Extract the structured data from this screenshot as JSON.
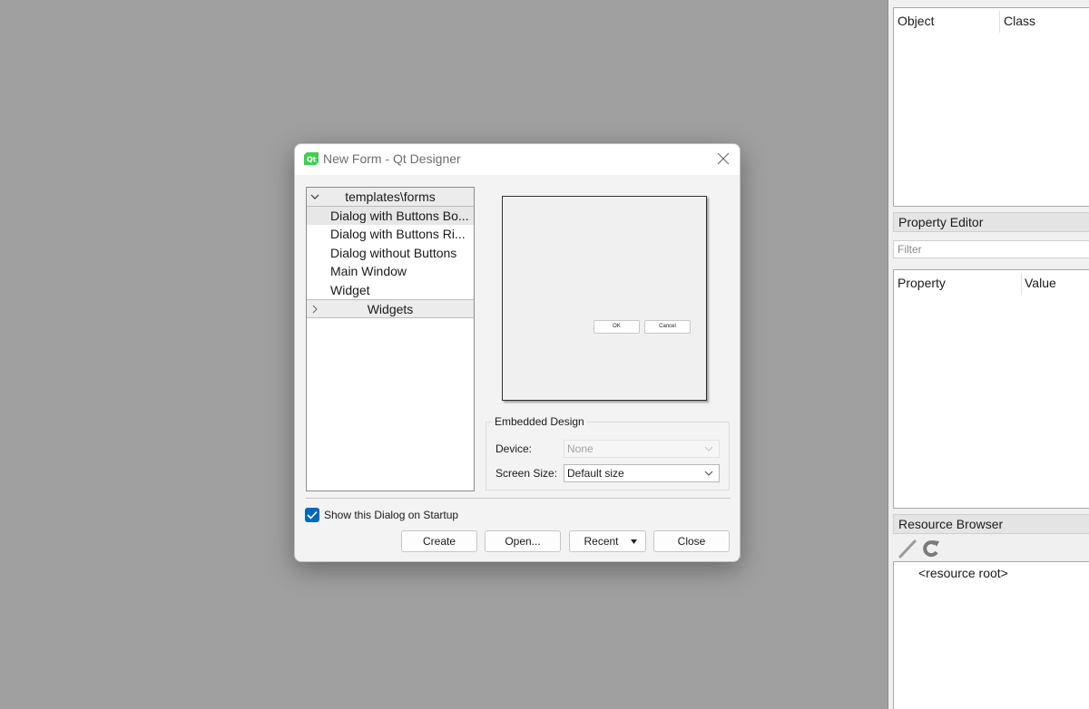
{
  "dock": {
    "object_inspector": {
      "col_object": "Object",
      "col_class": "Class"
    },
    "property_editor": {
      "title": "Property Editor",
      "filter_placeholder": "Filter",
      "col_property": "Property",
      "col_value": "Value"
    },
    "resource_browser": {
      "title": "Resource Browser",
      "root": "<resource root>"
    }
  },
  "dialog": {
    "title": "New Form - Qt Designer",
    "tree": {
      "group1": "templates\\forms",
      "items": [
        "Dialog with Buttons Bo...",
        "Dialog with Buttons Ri...",
        "Dialog without Buttons",
        "Main Window",
        "Widget"
      ],
      "group2": "Widgets"
    },
    "preview": {
      "ok": "OK",
      "cancel": "Cancel"
    },
    "embedded": {
      "title": "Embedded Design",
      "device_label": "Device:",
      "device_value": "None",
      "screen_label": "Screen Size:",
      "screen_value": "Default size"
    },
    "show_on_startup": "Show this Dialog on Startup",
    "buttons": {
      "create": "Create",
      "open": "Open...",
      "recent": "Recent",
      "close": "Close"
    }
  }
}
